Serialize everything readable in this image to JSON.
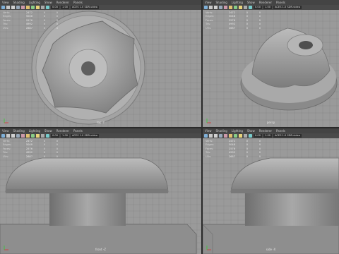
{
  "menu": [
    "View",
    "Shading",
    "Lighting",
    "Show",
    "Renderer",
    "Panels"
  ],
  "toolbar": {
    "num_a": "0.00",
    "num_b": "1.00",
    "color_space": "ACES 1.0 SDR-video"
  },
  "hud_labels": [
    "Verts:",
    "Edges:",
    "Faces:",
    "Tris:",
    "UVs:"
  ],
  "hud_values": [
    "2472",
    "5048",
    "2576",
    "4992",
    "2687"
  ],
  "hud_zeros": [
    "0",
    "0",
    "0",
    "0",
    "0"
  ],
  "viewports": {
    "top_left": {
      "label": "top -Y",
      "view": "top"
    },
    "top_right": {
      "label": "persp",
      "view": "persp"
    },
    "bottom_left": {
      "label": "front -Z",
      "view": "front"
    },
    "bottom_right": {
      "label": "side -X",
      "view": "side"
    }
  },
  "colors": {
    "viewport_bg": "#9a9a9a",
    "grid": "#888888",
    "model_light": "#b8b8b8",
    "model_dark": "#6e6e6e",
    "panel_chrome": "#444444"
  }
}
